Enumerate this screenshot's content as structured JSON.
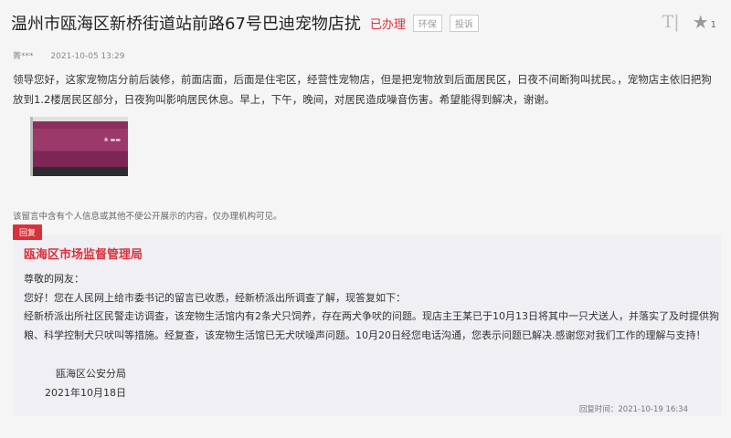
{
  "header": {
    "title": "温州市瓯海区新桥街道站前路67号巴迪宠物店扰",
    "status": "已办理",
    "tags": [
      "环保",
      "投诉"
    ],
    "font_icon": "T|",
    "star_count": "1"
  },
  "meta": {
    "author": "菁***",
    "time": "2021-10-05 13:29"
  },
  "post": {
    "content": "领导您好，这家宠物店分前后装修，前面店面，后面是住宅区，经营性宠物店，但是把宠物放到后面居民区，日夜不间断狗叫扰民。，宠物店主依旧把狗放到1.2楼居民区部分，日夜狗叫影响居民休息。早上，下午，晚间，对居民造成噪音伤害。希望能得到解决，谢谢。"
  },
  "notice": "该留言中含有个人信息或其他不便公开展示的内容，仅办理机构可见。",
  "reply": {
    "badge": "回复",
    "org": "瓯海区市场监督管理局",
    "greeting": "尊敬的网友：",
    "line1": "您好！您在人民网上给市委书记的留言已收悉，经新桥派出所调查了解，现答复如下：",
    "line2": "经新桥派出所社区民警走访调查，该宠物生活馆内有2条犬只饲养，存在两犬争吠的问题。现店主王某已于10月13日将其中一只犬送人，并落实了及时提供狗粮、科学控制犬只吠叫等措施。经复查，该宠物生活馆已无犬吠噪声问题。10月20日经您电话沟通，您表示问题已解决.感谢您对我们工作的理解与支持！",
    "signer": "瓯海区公安分局",
    "sign_date": "2021年10月18日",
    "reply_time": "回复时间：2021-10-19 16:34"
  },
  "colors": {
    "accent": "#d9313b"
  }
}
